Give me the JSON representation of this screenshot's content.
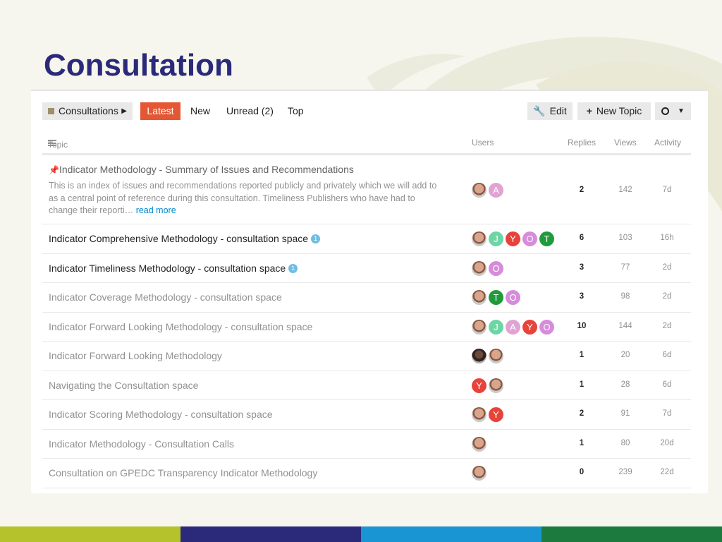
{
  "slide": {
    "title": "Consultation"
  },
  "nav": {
    "category": "Consultations",
    "tabs": [
      {
        "label": "Latest",
        "active": true
      },
      {
        "label": "New"
      },
      {
        "label": "Unread (2)"
      },
      {
        "label": "Top"
      }
    ],
    "edit": "Edit",
    "new_topic": "New Topic",
    "notifications_icon": "circle-icon"
  },
  "table": {
    "headers": {
      "topic": "Topic",
      "users": "Users",
      "replies": "Replies",
      "views": "Views",
      "activity": "Activity"
    },
    "pinned": {
      "title": "Indicator Methodology - Summary of Issues and Recommendations",
      "excerpt": "This is an index of issues and recommendations reported publicly and privately which we will add to as a central point of reference during this consultation. Timeliness Publishers who have had to change their reporti…",
      "read_more": "read more",
      "posters": [
        {
          "type": "photo"
        },
        {
          "letter": "A",
          "color": "#e0a3d4"
        }
      ],
      "replies": "2",
      "views": "142",
      "activity": "7d"
    },
    "rows": [
      {
        "title": "Indicator Comprehensive Methodology - consultation space",
        "unread": true,
        "badge": "1",
        "posters": [
          {
            "type": "photo"
          },
          {
            "letter": "J",
            "color": "#6dd6a5"
          },
          {
            "letter": "Y",
            "color": "#e8433a"
          },
          {
            "letter": "O",
            "color": "#d78bdb"
          },
          {
            "letter": "T",
            "color": "#1f9b3a"
          }
        ],
        "replies": "6",
        "views": "103",
        "activity": "16h"
      },
      {
        "title": "Indicator Timeliness Methodology - consultation space",
        "unread": true,
        "badge": "1",
        "posters": [
          {
            "type": "photo"
          },
          {
            "letter": "O",
            "color": "#d78bdb"
          }
        ],
        "replies": "3",
        "views": "77",
        "activity": "2d"
      },
      {
        "title": "Indicator Coverage Methodology - consultation space",
        "posters": [
          {
            "type": "photo"
          },
          {
            "letter": "T",
            "color": "#1f9b3a"
          },
          {
            "letter": "O",
            "color": "#d78bdb"
          }
        ],
        "replies": "3",
        "views": "98",
        "activity": "2d"
      },
      {
        "title": "Indicator Forward Looking Methodology - consultation space",
        "posters": [
          {
            "type": "photo"
          },
          {
            "letter": "J",
            "color": "#6dd6a5"
          },
          {
            "letter": "A",
            "color": "#e0a3d4"
          },
          {
            "letter": "Y",
            "color": "#e8433a"
          },
          {
            "letter": "O",
            "color": "#d78bdb"
          }
        ],
        "replies": "10",
        "views": "144",
        "activity": "2d"
      },
      {
        "title": "Indicator Forward Looking Methodology",
        "posters": [
          {
            "type": "photo2"
          },
          {
            "type": "photo"
          }
        ],
        "replies": "1",
        "views": "20",
        "activity": "6d"
      },
      {
        "title": "Navigating the Consultation space",
        "posters": [
          {
            "letter": "Y",
            "color": "#e8433a"
          },
          {
            "type": "photo"
          }
        ],
        "replies": "1",
        "views": "28",
        "activity": "6d"
      },
      {
        "title": "Indicator Scoring Methodology - consultation space",
        "posters": [
          {
            "type": "photo"
          },
          {
            "letter": "Y",
            "color": "#e8433a"
          }
        ],
        "replies": "2",
        "views": "91",
        "activity": "7d"
      },
      {
        "title": "Indicator Methodology - Consultation Calls",
        "posters": [
          {
            "type": "photo"
          }
        ],
        "replies": "1",
        "views": "80",
        "activity": "20d"
      },
      {
        "title": "Consultation on GPEDC Transparency Indicator Methodology",
        "posters": [
          {
            "type": "photo"
          }
        ],
        "replies": "0",
        "views": "239",
        "activity": "22d"
      }
    ]
  },
  "footer_colors": [
    "#b5c22c",
    "#2b2a7a",
    "#1a95d3",
    "#1c7a3e"
  ]
}
